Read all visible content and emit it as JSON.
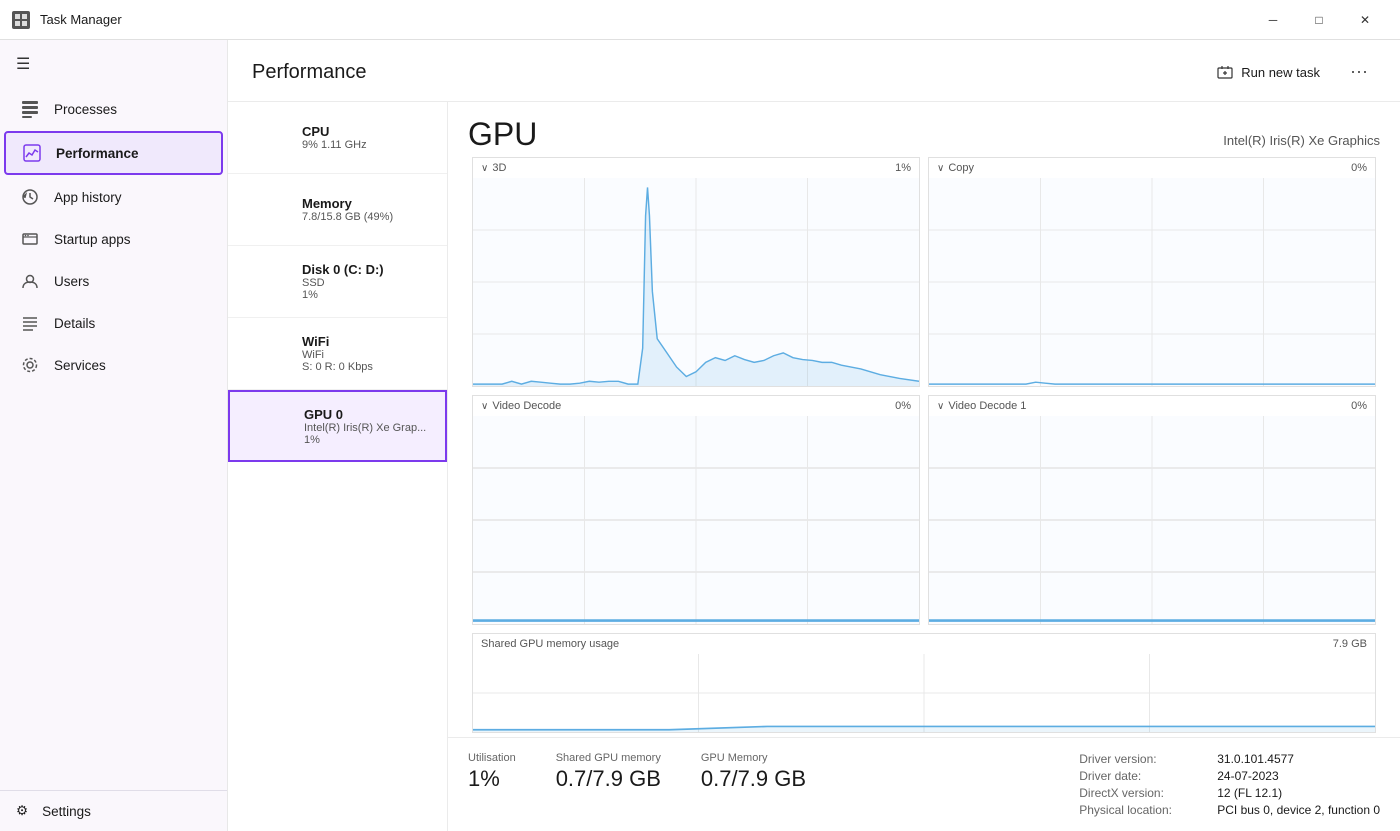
{
  "titlebar": {
    "title": "Task Manager",
    "icon": "task-manager",
    "minimize": "─",
    "maximize": "□",
    "close": "✕"
  },
  "sidebar": {
    "hamburger": "☰",
    "items": [
      {
        "id": "processes",
        "label": "Processes",
        "icon": "≡"
      },
      {
        "id": "performance",
        "label": "Performance",
        "icon": "▭",
        "active": true
      },
      {
        "id": "app-history",
        "label": "App history",
        "icon": "↺"
      },
      {
        "id": "startup-apps",
        "label": "Startup apps",
        "icon": "⊡"
      },
      {
        "id": "users",
        "label": "Users",
        "icon": "👤"
      },
      {
        "id": "details",
        "label": "Details",
        "icon": "☰"
      },
      {
        "id": "services",
        "label": "Services",
        "icon": "⚙"
      }
    ],
    "settings_label": "Settings",
    "settings_icon": "⚙"
  },
  "content": {
    "header": {
      "title": "Performance",
      "run_task_label": "Run new task",
      "more_icon": "⋯"
    },
    "perf_list": [
      {
        "id": "cpu",
        "name": "CPU",
        "sub": "9%  1.11 GHz",
        "val": "",
        "color": "#4a9ede"
      },
      {
        "id": "memory",
        "name": "Memory",
        "sub": "7.8/15.8 GB (49%)",
        "val": "",
        "color": "#9b59b6"
      },
      {
        "id": "disk",
        "name": "Disk 0 (C: D:)",
        "sub": "SSD",
        "val": "1%",
        "color": "#5dbd6e"
      },
      {
        "id": "wifi",
        "name": "WiFi",
        "sub": "WiFi",
        "val": "S: 0  R: 0 Kbps",
        "color": "#e0a020"
      },
      {
        "id": "gpu0",
        "name": "GPU 0",
        "sub": "Intel(R) Iris(R) Xe Grap...",
        "val": "1%",
        "color": "#5dade2",
        "selected": true
      }
    ],
    "gpu_detail": {
      "title": "GPU",
      "model": "Intel(R) Iris(R) Xe Graphics",
      "chart_3d_label": "3D",
      "chart_3d_pct": "1%",
      "chart_copy_label": "Copy",
      "chart_copy_pct": "0%",
      "chart_video_decode_label": "Video Decode",
      "chart_video_decode_pct": "0%",
      "chart_video_decode1_label": "Video Decode 1",
      "chart_video_decode1_pct": "0%",
      "memory_usage_label": "Shared GPU memory usage",
      "memory_usage_max": "7.9 GB",
      "stats": {
        "utilisation_label": "Utilisation",
        "utilisation_value": "1%",
        "shared_gpu_memory_label": "Shared GPU memory",
        "shared_gpu_memory_value": "0.7/7.9 GB",
        "gpu_memory_label": "GPU Memory",
        "gpu_memory_value": "0.7/7.9 GB"
      },
      "driver": {
        "driver_version_label": "Driver version:",
        "driver_version_value": "31.0.101.4577",
        "driver_date_label": "Driver date:",
        "driver_date_value": "24-07-2023",
        "directx_label": "DirectX version:",
        "directx_value": "12 (FL 12.1)",
        "physical_location_label": "Physical location:",
        "physical_location_value": "PCI bus 0, device 2, function 0"
      }
    }
  }
}
